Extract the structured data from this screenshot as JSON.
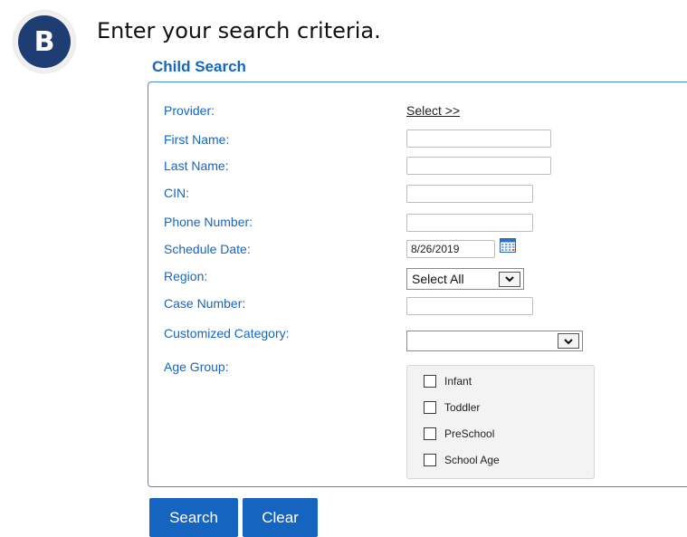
{
  "step": {
    "badge_letter": "B",
    "instruction": "Enter your search criteria."
  },
  "panel": {
    "title": "Child Search"
  },
  "fields": {
    "provider": {
      "label": "Provider:",
      "link": "Select  >>"
    },
    "first_name": {
      "label": "First Name:",
      "value": ""
    },
    "last_name": {
      "label": "Last Name:",
      "value": ""
    },
    "cin": {
      "label": "CIN:",
      "value": ""
    },
    "phone": {
      "label": "Phone Number:",
      "value": ""
    },
    "schedule_date": {
      "label": "Schedule Date:",
      "value": "8/26/2019"
    },
    "region": {
      "label": "Region:",
      "selected": "Select All"
    },
    "case_number": {
      "label": "Case Number:",
      "value": ""
    },
    "customized_category": {
      "label": "Customized Category:",
      "selected": ""
    },
    "age_group": {
      "label": "Age Group:",
      "options": [
        {
          "label": "Infant",
          "checked": false
        },
        {
          "label": "Toddler",
          "checked": false
        },
        {
          "label": "PreSchool",
          "checked": false
        },
        {
          "label": "School Age",
          "checked": false
        }
      ]
    }
  },
  "buttons": {
    "search": "Search",
    "clear": "Clear"
  },
  "icons": {
    "calendar": "calendar-icon",
    "region_dropdown": "chevron-down-icon",
    "category_dropdown": "chevron-down-icon"
  },
  "colors": {
    "label_blue": "#1566c0",
    "button_blue": "#1565c0",
    "panel_border": "#4a8fd6",
    "badge_navy": "#1e3d73"
  }
}
